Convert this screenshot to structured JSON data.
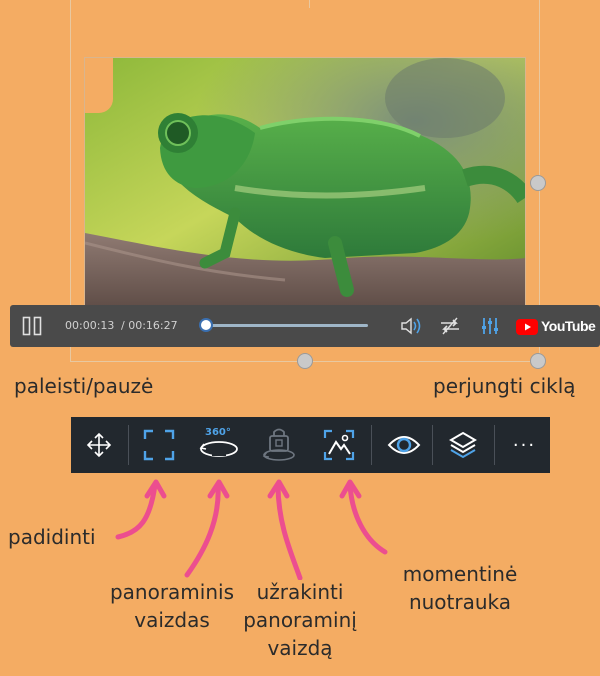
{
  "player": {
    "current_time": "00:00:13",
    "duration": "/ 00:16:27",
    "progress_fraction": 0.0,
    "youtube_label": "YouTube"
  },
  "labels": {
    "play_pause": "paleisti/pauzė",
    "toggle_loop": "perjungti ciklą",
    "maximize": "padidinti",
    "panoramic_line1": "panoraminis",
    "panoramic_line2": "vaizdas",
    "lock_line1": "užrakinti",
    "lock_line2": "panoraminį",
    "lock_line3": "vaizdą",
    "snapshot_line1": "momentinė",
    "snapshot_line2": "nuotrauka"
  },
  "toolbar": {
    "badge_360": "360°",
    "more": "···"
  },
  "colors": {
    "background": "#F4AC63",
    "toolbar": "#22282E",
    "player_bar": "#4A4A4A",
    "icon_blue": "#4FA3E8",
    "arrow_pink": "#EC4E8F"
  },
  "icons": [
    "pause-icon",
    "volume-icon",
    "loop-icon",
    "equalizer-icon",
    "youtube-logo",
    "move-icon",
    "maximize-icon",
    "panorama-360-icon",
    "lock-panorama-icon",
    "snapshot-icon",
    "eye-icon",
    "layers-icon",
    "more-icon"
  ]
}
